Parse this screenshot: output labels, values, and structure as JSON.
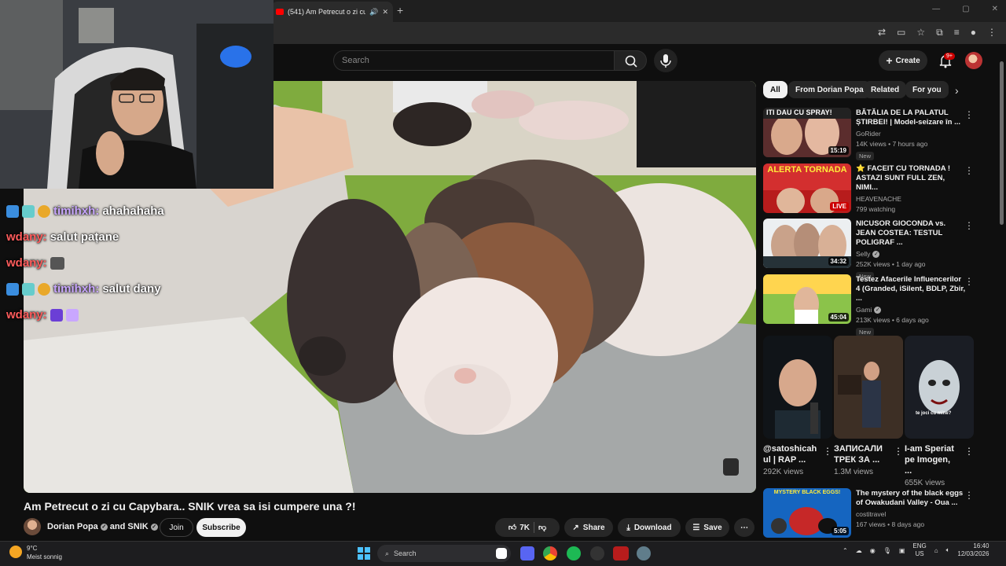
{
  "browser": {
    "tab_title": "(541) Am Petrecut o zi cu C",
    "new_tab": "+",
    "window_controls": [
      "—",
      "▢",
      "✕"
    ]
  },
  "header": {
    "search_placeholder": "Search",
    "create_label": "Create",
    "notification_count": "9+"
  },
  "stream_chat": [
    {
      "user": "timihxh:",
      "message": "ahahahaha",
      "user_color": "#c9a7ff"
    },
    {
      "user": "wdany:",
      "message": "salut pațane",
      "user_color": "#ff5c5c"
    },
    {
      "user": "wdany:",
      "message": "",
      "user_color": "#ff5c5c"
    },
    {
      "user": "timihxh:",
      "message": "salut dany",
      "user_color": "#c9a7ff"
    },
    {
      "user": "wdany:",
      "message": "",
      "user_color": "#ff5c5c"
    }
  ],
  "video": {
    "title": "Am Petrecut o zi cu Capybara.. SNIK vrea sa isi cumpere una ?!",
    "channel": "Dorian Popa",
    "collab": "and SNIK",
    "join_label": "Join",
    "subscribe_label": "Subscribe",
    "likes": "7K",
    "share_label": "Share",
    "download_label": "Download",
    "save_label": "Save"
  },
  "chips": [
    "All",
    "From Dorian Popa",
    "Related",
    "For you"
  ],
  "recommendations": [
    {
      "title": "BĂTĂLIA DE LA PALATUL ȘTIRBEI! | Model-seizare în ...",
      "channel": "GoRider",
      "verified": false,
      "meta": "14K views • 7 hours ago",
      "duration": "15:19",
      "new": "New",
      "thumb_text": "ITI DAU CU SPRAY!"
    },
    {
      "title": "⭐ FACEIT CU TORNADA ! ASTAZI SUNT FULL ZEN, NIMI...",
      "channel": "HEAVENACHE",
      "verified": false,
      "meta": "799 watching",
      "duration": "LIVE",
      "new": "",
      "thumb_text": "ALERTA TORNADA"
    },
    {
      "title": "NICUSOR GIOCONDA vs. JEAN COSTEA: TESTUL POLIGRAF ...",
      "channel": "Selly",
      "verified": true,
      "meta": "252K views • 1 day ago",
      "duration": "34:32",
      "new": "New",
      "thumb_text": ""
    },
    {
      "title": "Testez Afacerile Influencerilor 4 (Granded, iSilent, BDLP, Zbir, ...",
      "channel": "Gami",
      "verified": true,
      "meta": "213K views • 6 days ago",
      "duration": "45:04",
      "new": "New",
      "thumb_text": ""
    },
    {
      "title": "The mystery of the black eggs of Owakudani Valley - Oua ...",
      "channel": "costitravel",
      "verified": false,
      "meta": "167 views • 8 days ago",
      "duration": "5:05",
      "new": "",
      "thumb_text": "MYSTERY BLACK EGGS!"
    }
  ],
  "shorts": [
    {
      "title": "@satoshicah ul | RAP ...",
      "views": "292K views"
    },
    {
      "title": "ЗАПИСАЛИ ТРЕК ЗА ...",
      "views": "1.3M views"
    },
    {
      "title": "I-am Speriat pe Imogen, ...",
      "views": "655K views"
    }
  ],
  "shorts_overlay_text": "te joci cu mine?",
  "taskbar": {
    "temperature": "9°C",
    "weather": "Meist sonnig",
    "search_placeholder": "Search",
    "language": "ENG",
    "region": "US",
    "time": "16:40",
    "date": "12/03/2026"
  },
  "colors": {
    "background": "#0f0f0f",
    "chip_bg": "#272727",
    "accent_red": "#ff0000"
  }
}
